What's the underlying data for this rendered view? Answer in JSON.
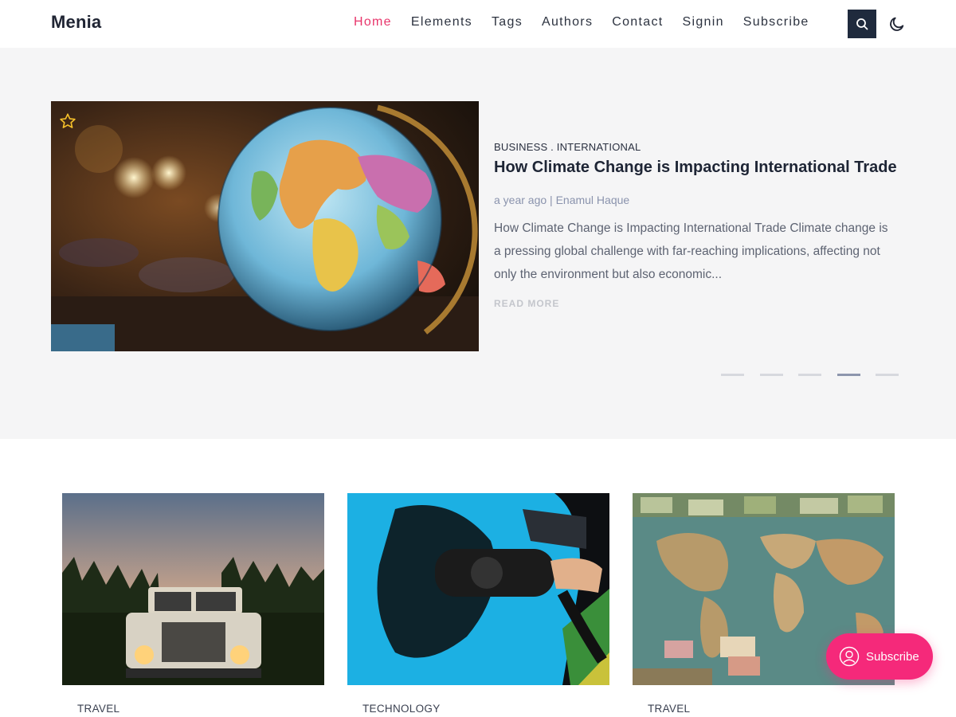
{
  "header": {
    "logo": "Menia",
    "nav": [
      "Home",
      "Elements",
      "Tags",
      "Authors",
      "Contact",
      "Signin",
      "Subscribe"
    ],
    "active_nav": "Home",
    "search_icon": "search-icon",
    "theme_icon": "moon-icon"
  },
  "hero": {
    "categories": "BUSINESS . INTERNATIONAL",
    "title": "How Climate Change is Impacting International Trade",
    "meta": "a year ago | Enamul Haque",
    "excerpt": "How Climate Change is Impacting International Trade Climate change is a pressing global challenge with far-reaching implications, affecting not only the environment but also economic...",
    "read_more": "READ MORE",
    "featured_icon": "star-icon",
    "slide_count": 5,
    "active_slide": 4
  },
  "cards": [
    {
      "category": "TRAVEL"
    },
    {
      "category": "TECHNOLOGY"
    },
    {
      "category": "TRAVEL"
    }
  ],
  "floating": {
    "subscribe_label": "Subscribe",
    "icon": "user-icon"
  },
  "colors": {
    "accent": "#e8356b",
    "subscribe_bg": "#f5297a",
    "search_bg": "#1f2a3d",
    "hero_bg": "#f5f5f6"
  }
}
